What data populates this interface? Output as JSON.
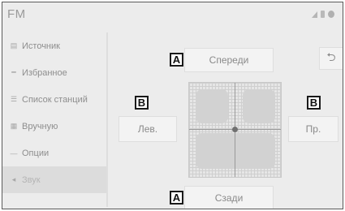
{
  "header": {
    "title": "FM",
    "status_icons": [
      "signal-icon",
      "phone-icon",
      "bluetooth-icon"
    ]
  },
  "sidebar": {
    "items": [
      {
        "icon": "source-icon",
        "glyph": "▤",
        "label": "Источник"
      },
      {
        "icon": "favorites-icon",
        "glyph": "━",
        "label": "Избранное"
      },
      {
        "icon": "station-list-icon",
        "glyph": "☰",
        "label": "Список станций"
      },
      {
        "icon": "manual-icon",
        "glyph": "▦",
        "label": "Вручную"
      },
      {
        "icon": "options-icon",
        "glyph": "—",
        "label": "Опции"
      },
      {
        "icon": "sound-icon",
        "glyph": "◂",
        "label": "Звук",
        "active": true
      }
    ]
  },
  "balance": {
    "front_label": "Спереди",
    "back_label": "Сзади",
    "left_label": "Лев.",
    "right_label": "Пр.",
    "back_nav_glyph": "⮌"
  },
  "markers": {
    "a": "A",
    "b": "B"
  }
}
